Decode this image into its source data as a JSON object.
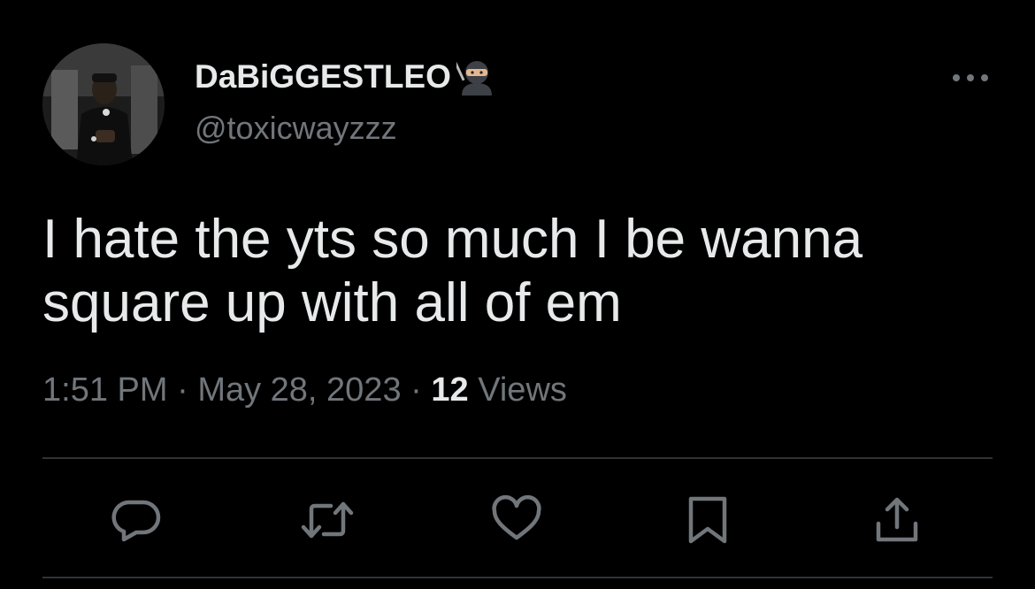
{
  "user": {
    "display_name": "DaBiGGESTLEO",
    "handle": "@toxicwayzzz",
    "emoji_icon": "ninja-emoji"
  },
  "tweet": {
    "text": "I hate the yts so much I be wanna square up with all of em"
  },
  "meta": {
    "time": "1:51 PM",
    "separator": "·",
    "date": "May 28, 2023",
    "views_count": "12",
    "views_label": "Views"
  },
  "actions": [
    {
      "name": "reply",
      "icon": "reply-icon"
    },
    {
      "name": "retweet",
      "icon": "retweet-icon"
    },
    {
      "name": "like",
      "icon": "heart-icon"
    },
    {
      "name": "bookmark",
      "icon": "bookmark-icon"
    },
    {
      "name": "share",
      "icon": "share-icon"
    }
  ],
  "colors": {
    "background": "#000000",
    "text_primary": "#e7e9ea",
    "text_secondary": "#71767b",
    "divider": "#2f3336"
  }
}
